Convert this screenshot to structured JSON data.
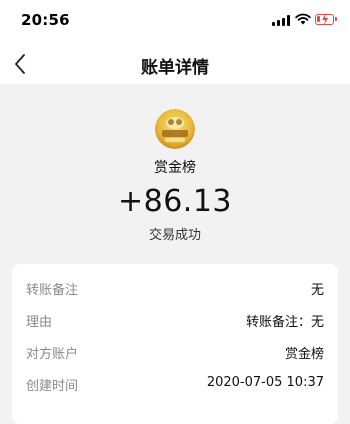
{
  "status_bar": {
    "time": "20:56"
  },
  "nav": {
    "title": "账单详情"
  },
  "transaction": {
    "merchant_name": "赏金榜",
    "amount": "+86.13",
    "status": "交易成功"
  },
  "details": [
    {
      "label": "转账备注",
      "value": "无"
    },
    {
      "label": "理由",
      "value": "转账备注：无"
    },
    {
      "label": "对方账户",
      "value": "赏金榜"
    },
    {
      "label": "创建时间",
      "value": "2020-07-05 10:37"
    }
  ],
  "colors": {
    "accent_gold": "#e8b83a",
    "battery_red": "#e54b4b",
    "background": "#f2f2f2"
  }
}
